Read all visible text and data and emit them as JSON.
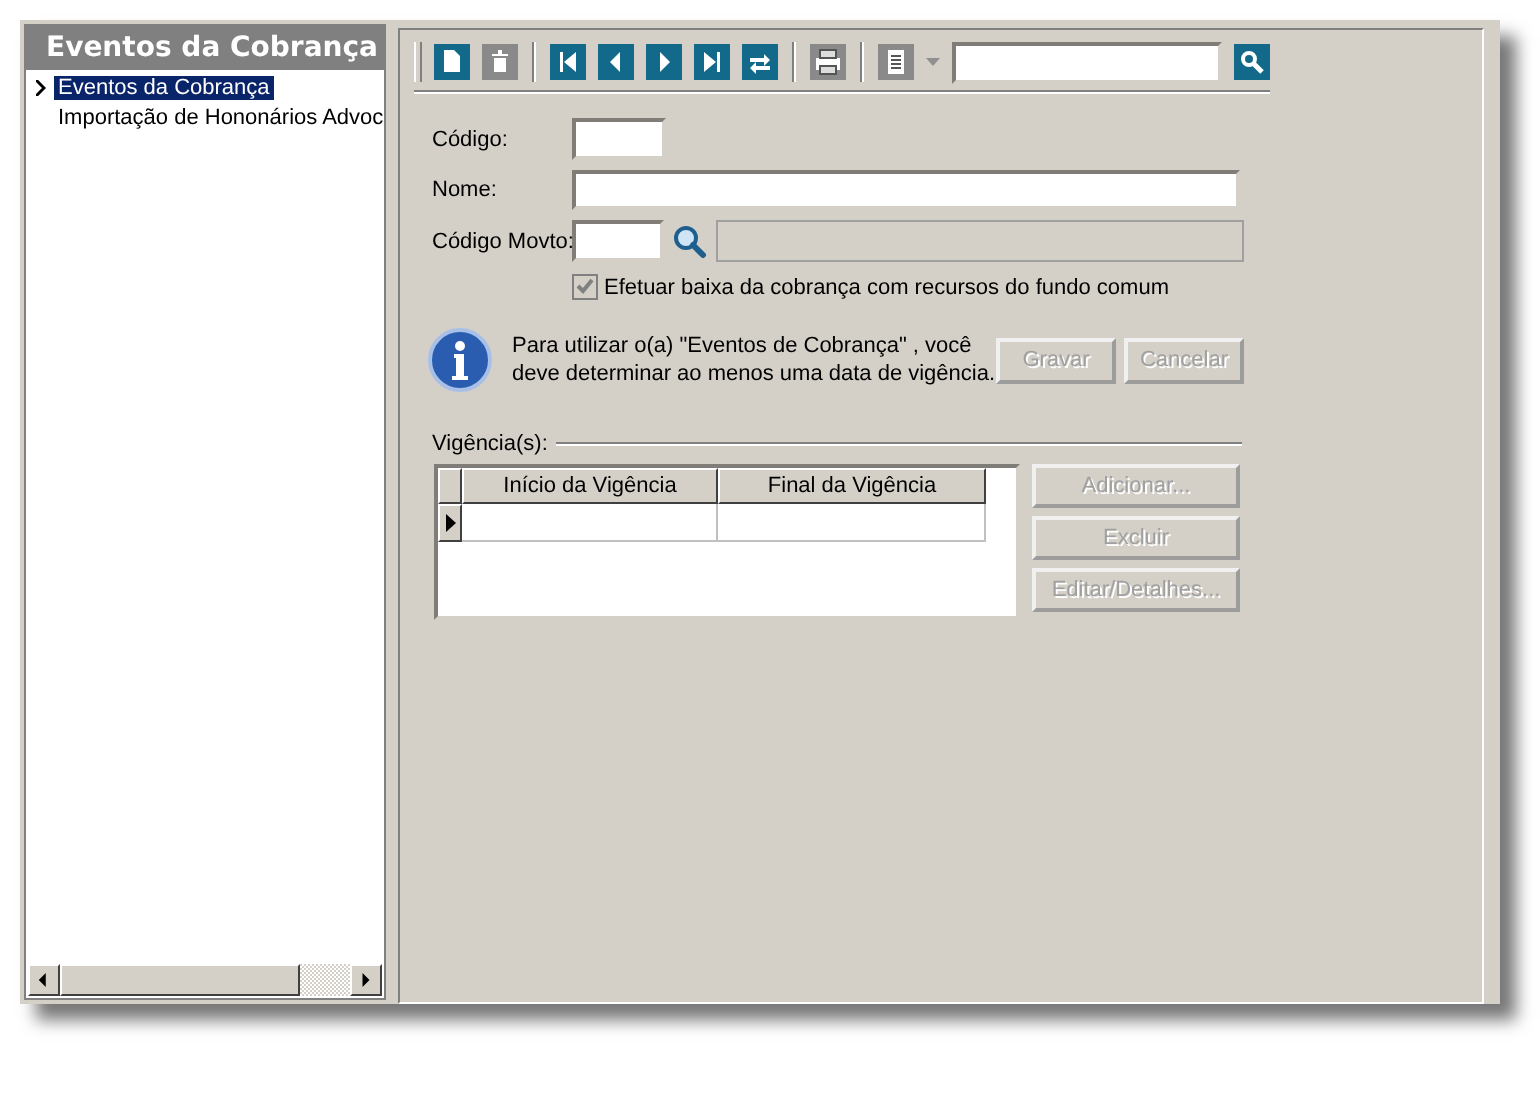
{
  "sidebar": {
    "title": "Eventos da Cobrança",
    "items": [
      {
        "label": "Eventos da Cobrança",
        "selected": true
      },
      {
        "label": "Importação de Hononários Advoc",
        "selected": false
      }
    ]
  },
  "toolbar": {
    "buttons": [
      {
        "kind": "new",
        "disabled": false
      },
      {
        "kind": "delete",
        "disabled": true
      },
      {
        "kind": "sep"
      },
      {
        "kind": "first",
        "disabled": false
      },
      {
        "kind": "prev",
        "disabled": false
      },
      {
        "kind": "next",
        "disabled": false
      },
      {
        "kind": "last",
        "disabled": false
      },
      {
        "kind": "refresh",
        "disabled": false
      },
      {
        "kind": "sep"
      },
      {
        "kind": "print",
        "disabled": true
      },
      {
        "kind": "sep"
      },
      {
        "kind": "list",
        "disabled": true
      }
    ]
  },
  "form": {
    "codigo_label": "Código:",
    "nome_label": "Nome:",
    "movto_label": "Código Movto:",
    "checkbox": {
      "label": "Efetuar baixa da cobrança com recursos do fundo comum",
      "checked": true,
      "disabled": true
    },
    "info": "Para utilizar o(a) \"Eventos de Cobrança\" , você deve determinar ao menos uma data de vigência.",
    "actions": [
      {
        "label": "Gravar",
        "disabled": true
      },
      {
        "label": "Cancelar",
        "disabled": true
      }
    ]
  },
  "vigencias": {
    "title": "Vigência(s):",
    "columns": [
      "Início da Vigência",
      "Final da Vigência"
    ],
    "buttons": [
      {
        "label": "Adicionar...",
        "disabled": true
      },
      {
        "label": "Excluir",
        "disabled": true
      },
      {
        "label": "Editar/Detalhes...",
        "disabled": true
      }
    ]
  }
}
